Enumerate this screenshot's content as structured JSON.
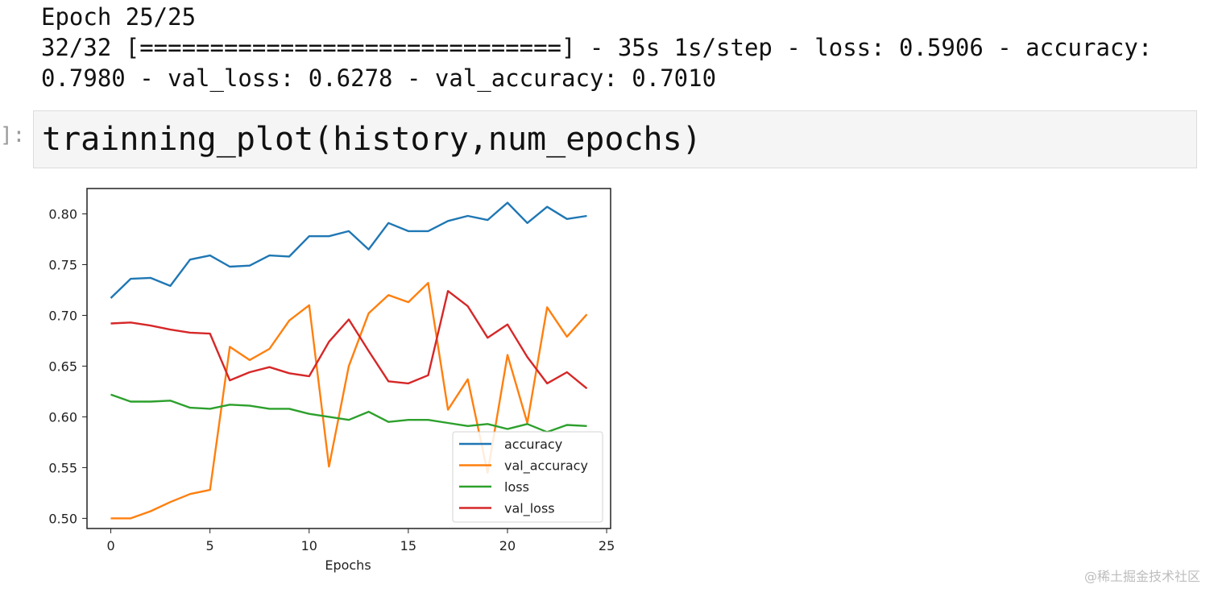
{
  "output": {
    "line1": "Epoch 25/25",
    "line2": "32/32 [==============================] - 35s 1s/step - loss: 0.5906 - accuracy:",
    "line3": "0.7980 - val_loss: 0.6278 - val_accuracy: 0.7010"
  },
  "cell": {
    "prompt": "]:",
    "code": "trainning_plot(history,num_epochs)"
  },
  "watermark": "@稀土掘金技术社区",
  "chart_data": {
    "type": "line",
    "xlabel": "Epochs",
    "ylabel": "",
    "title": "",
    "xlim": [
      -1.2,
      25.2
    ],
    "ylim": [
      0.49,
      0.825
    ],
    "xticks": [
      0,
      5,
      10,
      15,
      20,
      25
    ],
    "yticks": [
      0.5,
      0.55,
      0.6,
      0.65,
      0.7,
      0.75,
      0.8
    ],
    "ytick_labels": [
      "0.50",
      "0.55",
      "0.60",
      "0.65",
      "0.70",
      "0.75",
      "0.80"
    ],
    "legend_position": "lower-right",
    "grid": false,
    "x": [
      0,
      1,
      2,
      3,
      4,
      5,
      6,
      7,
      8,
      9,
      10,
      11,
      12,
      13,
      14,
      15,
      16,
      17,
      18,
      19,
      20,
      21,
      22,
      23,
      24
    ],
    "series": [
      {
        "name": "accuracy",
        "color": "#1f77b4",
        "values": [
          0.717,
          0.736,
          0.737,
          0.729,
          0.755,
          0.759,
          0.748,
          0.749,
          0.759,
          0.758,
          0.778,
          0.778,
          0.783,
          0.765,
          0.791,
          0.783,
          0.783,
          0.793,
          0.798,
          0.794,
          0.811,
          0.791,
          0.807,
          0.795,
          0.798
        ]
      },
      {
        "name": "val_accuracy",
        "color": "#ff7f0e",
        "values": [
          0.5,
          0.5,
          0.507,
          0.516,
          0.524,
          0.528,
          0.669,
          0.656,
          0.667,
          0.695,
          0.71,
          0.551,
          0.65,
          0.702,
          0.72,
          0.713,
          0.732,
          0.607,
          0.637,
          0.545,
          0.661,
          0.594,
          0.708,
          0.679,
          0.701
        ]
      },
      {
        "name": "loss",
        "color": "#2ca02c",
        "values": [
          0.622,
          0.615,
          0.615,
          0.616,
          0.609,
          0.608,
          0.612,
          0.611,
          0.608,
          0.608,
          0.603,
          0.6,
          0.597,
          0.605,
          0.595,
          0.597,
          0.597,
          0.594,
          0.591,
          0.593,
          0.588,
          0.593,
          0.585,
          0.592,
          0.591
        ]
      },
      {
        "name": "val_loss",
        "color": "#d62728",
        "values": [
          0.692,
          0.693,
          0.69,
          0.686,
          0.683,
          0.682,
          0.636,
          0.644,
          0.649,
          0.643,
          0.64,
          0.674,
          0.696,
          0.665,
          0.635,
          0.633,
          0.641,
          0.724,
          0.709,
          0.678,
          0.691,
          0.659,
          0.633,
          0.644,
          0.628
        ]
      }
    ]
  }
}
